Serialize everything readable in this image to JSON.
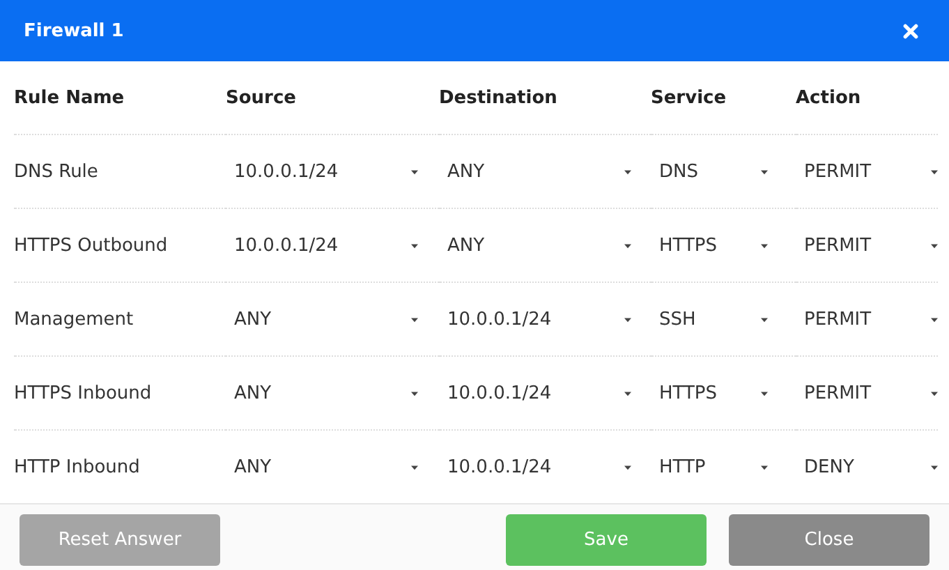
{
  "window": {
    "title": "Firewall 1"
  },
  "table": {
    "columns": [
      "Rule Name",
      "Source",
      "Destination",
      "Service",
      "Action"
    ],
    "rows": [
      {
        "rule_name": "DNS Rule",
        "source": "10.0.0.1/24",
        "destination": "ANY",
        "service": "DNS",
        "action": "PERMIT"
      },
      {
        "rule_name": "HTTPS Outbound",
        "source": "10.0.0.1/24",
        "destination": "ANY",
        "service": "HTTPS",
        "action": "PERMIT"
      },
      {
        "rule_name": "Management",
        "source": "ANY",
        "destination": "10.0.0.1/24",
        "service": "SSH",
        "action": "PERMIT"
      },
      {
        "rule_name": "HTTPS Inbound",
        "source": "ANY",
        "destination": "10.0.0.1/24",
        "service": "HTTPS",
        "action": "PERMIT"
      },
      {
        "rule_name": "HTTP Inbound",
        "source": "ANY",
        "destination": "10.0.0.1/24",
        "service": "HTTP",
        "action": "DENY"
      }
    ]
  },
  "buttons": [
    {
      "label": "Reset Answer",
      "kind": "reset"
    },
    {
      "label": "Save",
      "kind": "save"
    },
    {
      "label": "Close",
      "kind": "close"
    }
  ]
}
